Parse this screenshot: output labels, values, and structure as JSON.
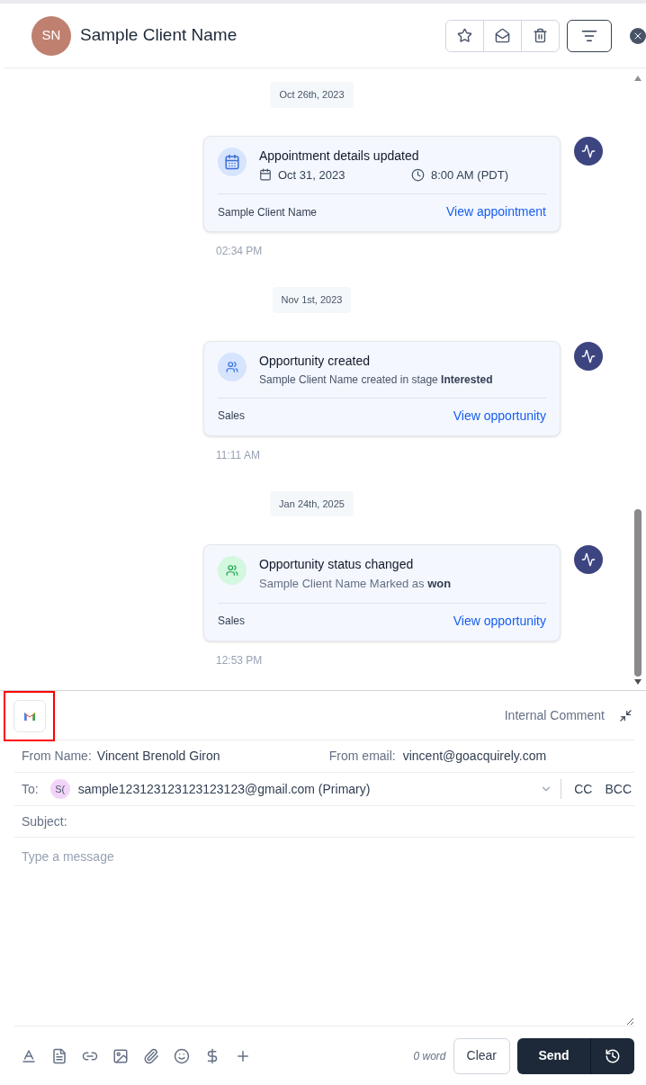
{
  "header": {
    "avatar_initials": "SN",
    "contact_name": "Sample Client Name"
  },
  "timeline": [
    {
      "date": "Oct 26th, 2023",
      "kind": "appointment",
      "title": "Appointment details updated",
      "appt_date": "Oct 31, 2023",
      "appt_time": "8:00 AM (PDT)",
      "footer": "Sample Client Name",
      "link": "View appointment",
      "time": "02:34 PM"
    },
    {
      "date": "Nov 1st, 2023",
      "kind": "opportunity",
      "title": "Opportunity created",
      "description": "Sample Client Name created in stage **Interested**",
      "footer": "Sales",
      "link": "View opportunity",
      "time": "11:11 AM"
    },
    {
      "date": "Jan 24th, 2025",
      "kind": "status",
      "title": "Opportunity status changed",
      "description": "Sample Client Name Marked as **won**",
      "footer": "Sales",
      "link": "View opportunity",
      "time": "12:53 PM"
    }
  ],
  "composer": {
    "channel_highlighted": true,
    "internal_comment": "Internal Comment",
    "from_name_label": "From Name:",
    "from_name": "Vincent Brenold Giron",
    "from_email_label": "From email:",
    "from_email": "vincent@goacquirely.com",
    "to_label": "To:",
    "recipient_initials": "S(",
    "recipient": "sample123123123123123123@gmail.com (Primary)",
    "cc": "CC",
    "bcc": "BCC",
    "subject_label": "Subject:",
    "message_placeholder": "Type a message",
    "word_count": "0 word",
    "clear": "Clear",
    "send": "Send"
  }
}
